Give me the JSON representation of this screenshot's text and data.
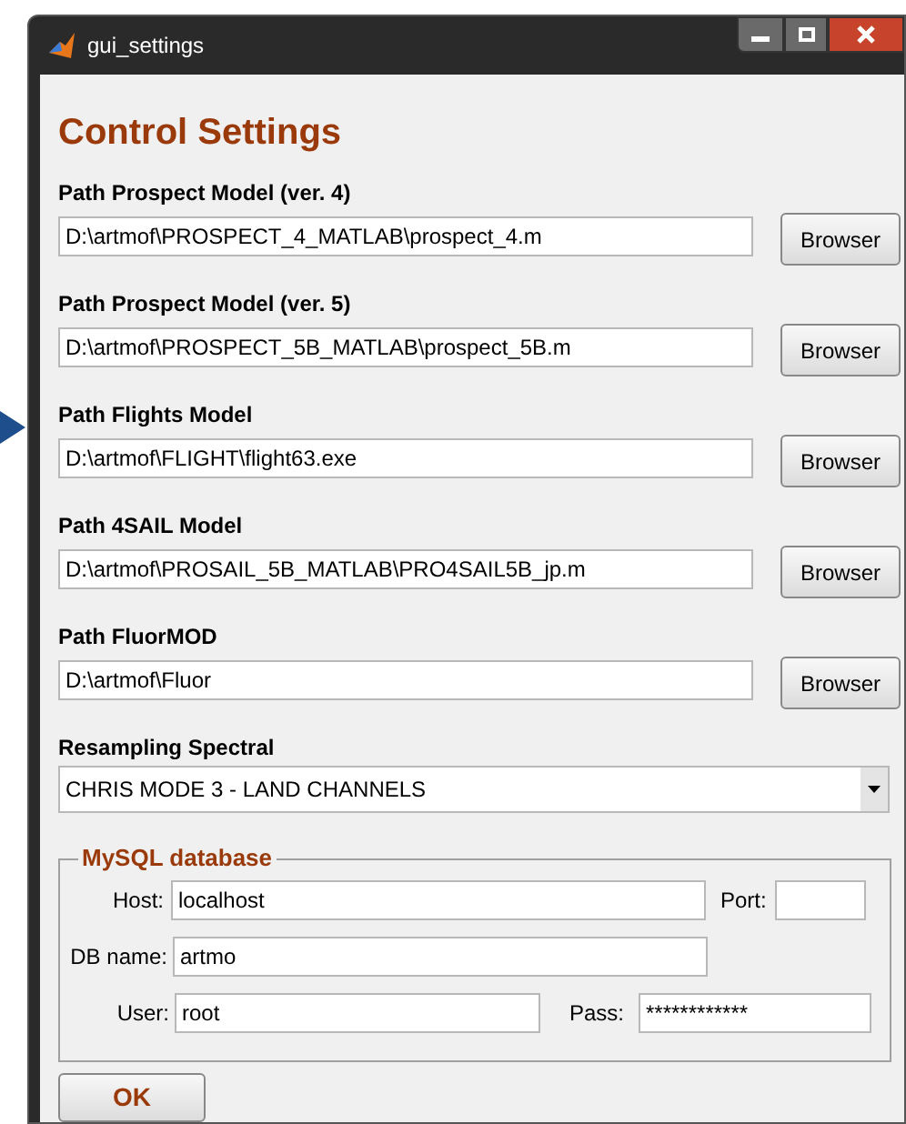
{
  "window": {
    "title": "gui_settings"
  },
  "heading": "Control Settings",
  "paths": [
    {
      "label": "Path Prospect Model (ver. 4)",
      "value": "D:\\artmof\\PROSPECT_4_MATLAB\\prospect_4.m",
      "button": "Browser"
    },
    {
      "label": "Path Prospect Model (ver. 5)",
      "value": "D:\\artmof\\PROSPECT_5B_MATLAB\\prospect_5B.m",
      "button": "Browser"
    },
    {
      "label": "Path Flights Model",
      "value": "D:\\artmof\\FLIGHT\\flight63.exe",
      "button": "Browser"
    },
    {
      "label": "Path 4SAIL Model",
      "value": "D:\\artmof\\PROSAIL_5B_MATLAB\\PRO4SAIL5B_jp.m",
      "button": "Browser"
    },
    {
      "label": "Path FluorMOD",
      "value": "D:\\artmof\\Fluor",
      "button": "Browser"
    }
  ],
  "resampling": {
    "label": "Resampling Spectral",
    "value": "CHRIS MODE 3 - LAND CHANNELS"
  },
  "mysql": {
    "title": "MySQL database",
    "host": {
      "label": "Host:",
      "value": "localhost"
    },
    "port": {
      "label": "Port:"
    },
    "db_name": {
      "label": "DB name:",
      "value": "artmo"
    },
    "user": {
      "label": "User:",
      "value": "root"
    },
    "pass": {
      "label": "Pass:",
      "value": "************"
    }
  },
  "ok_button": "OK"
}
